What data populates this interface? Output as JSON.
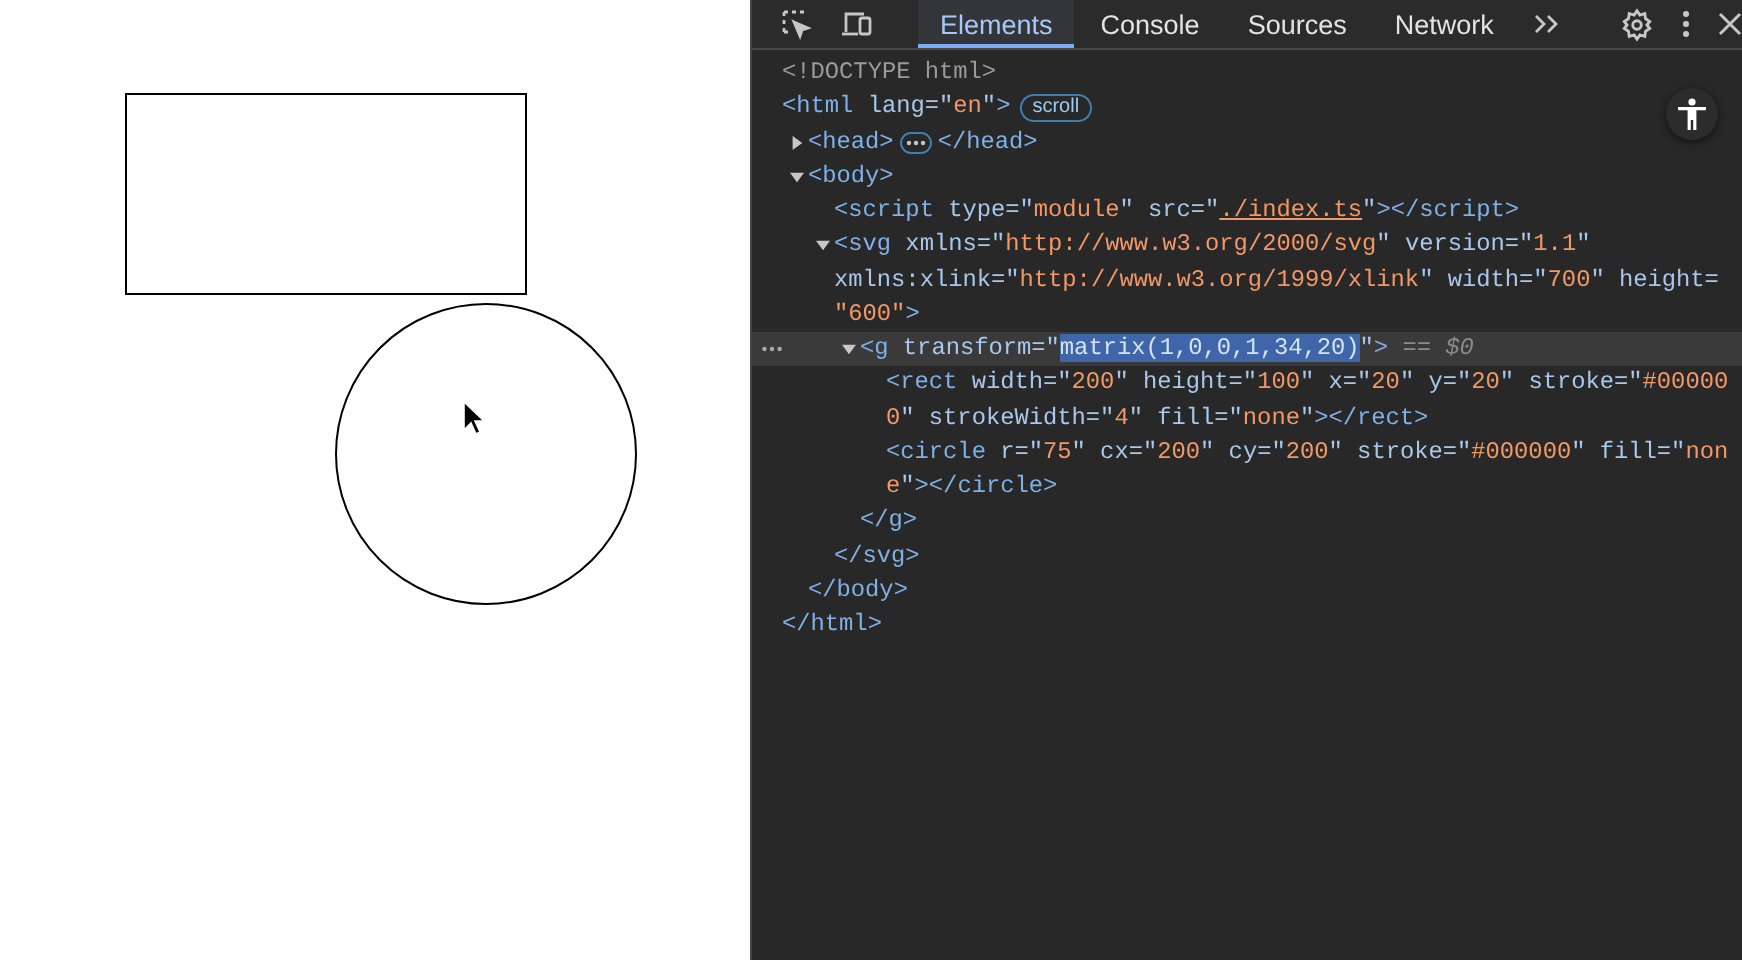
{
  "toolbar": {
    "tabs": [
      {
        "label": "Elements",
        "selected": true
      },
      {
        "label": "Console",
        "selected": false
      },
      {
        "label": "Sources",
        "selected": false
      },
      {
        "label": "Network",
        "selected": false
      }
    ]
  },
  "dom_tree": [
    {
      "selected": false,
      "lines": [
        [
          {
            "kind": "doctype",
            "t": "<!DOCTYPE html>"
          }
        ]
      ]
    },
    {
      "selected": false,
      "lines": [
        [
          {
            "kind": "tag",
            "t": "<html"
          },
          {
            "kind": "attr",
            "t": " lang=\""
          },
          {
            "kind": "val",
            "t": "en"
          },
          {
            "kind": "attr",
            "t": "\""
          },
          {
            "kind": "tag",
            "t": ">"
          },
          {
            "kind": "badge",
            "t": "scroll"
          }
        ]
      ],
      "close": [
        {
          "kind": "tag",
          "t": "</html>"
        }
      ],
      "children": [
        {
          "selected": false,
          "expanded": false,
          "lines": [
            [
              {
                "kind": "tag",
                "t": "<head>"
              },
              {
                "kind": "ellipsis"
              },
              {
                "kind": "tag",
                "t": "</head>"
              }
            ]
          ]
        },
        {
          "selected": false,
          "expanded": true,
          "lines": [
            [
              {
                "kind": "tag",
                "t": "<body>"
              }
            ]
          ],
          "close": [
            {
              "kind": "tag",
              "t": "</body>"
            }
          ],
          "children": [
            {
              "selected": false,
              "lines": [
                [
                  {
                    "kind": "tag",
                    "t": "<script"
                  },
                  {
                    "kind": "attr",
                    "t": " type=\""
                  },
                  {
                    "kind": "val",
                    "t": "module"
                  },
                  {
                    "kind": "attr",
                    "t": "\" src=\""
                  },
                  {
                    "kind": "link",
                    "t": "./index.ts"
                  },
                  {
                    "kind": "attr",
                    "t": "\""
                  },
                  {
                    "kind": "tag",
                    "t": "></script>"
                  }
                ]
              ]
            },
            {
              "selected": false,
              "expanded": true,
              "lines": [
                [
                  {
                    "kind": "tag",
                    "t": "<svg"
                  },
                  {
                    "kind": "attr",
                    "t": " xmlns=\""
                  },
                  {
                    "kind": "val",
                    "t": "http://www.w3.org/2000/svg"
                  },
                  {
                    "kind": "attr",
                    "t": "\" version=\""
                  },
                  {
                    "kind": "val",
                    "t": "1.1"
                  },
                  {
                    "kind": "attr",
                    "t": "\""
                  }
                ],
                [
                  {
                    "kind": "attr",
                    "t": "xmlns:xlink=\""
                  },
                  {
                    "kind": "val",
                    "t": "http://www.w3.org/1999/xlink"
                  },
                  {
                    "kind": "attr",
                    "t": "\" width=\""
                  },
                  {
                    "kind": "val",
                    "t": "700"
                  },
                  {
                    "kind": "attr",
                    "t": "\" height="
                  }
                ],
                [
                  {
                    "kind": "val",
                    "t": "\"600\""
                  },
                  {
                    "kind": "tag",
                    "t": ">"
                  }
                ]
              ],
              "close": [
                {
                  "kind": "tag",
                  "t": "</svg>"
                }
              ],
              "children": [
                {
                  "selected": true,
                  "expanded": true,
                  "lines": [
                    [
                      {
                        "kind": "tag",
                        "t": "<g"
                      },
                      {
                        "kind": "attr",
                        "t": " transform=\""
                      },
                      {
                        "kind": "sel",
                        "t": "matrix(1,0,0,1,34,20)"
                      },
                      {
                        "kind": "attr",
                        "t": "\""
                      },
                      {
                        "kind": "tag",
                        "t": ">"
                      },
                      {
                        "kind": "dim",
                        "t": " == $0"
                      }
                    ]
                  ],
                  "close": [
                    {
                      "kind": "tag",
                      "t": "</g>"
                    }
                  ],
                  "children": [
                    {
                      "selected": false,
                      "lines": [
                        [
                          {
                            "kind": "tag",
                            "t": "<rect"
                          },
                          {
                            "kind": "attr",
                            "t": " width=\""
                          },
                          {
                            "kind": "val",
                            "t": "200"
                          },
                          {
                            "kind": "attr",
                            "t": "\" height=\""
                          },
                          {
                            "kind": "val",
                            "t": "100"
                          },
                          {
                            "kind": "attr",
                            "t": "\" x=\""
                          },
                          {
                            "kind": "val",
                            "t": "20"
                          },
                          {
                            "kind": "attr",
                            "t": "\" y=\""
                          },
                          {
                            "kind": "val",
                            "t": "20"
                          },
                          {
                            "kind": "attr",
                            "t": "\" stroke=\""
                          },
                          {
                            "kind": "val",
                            "t": "#00000"
                          }
                        ],
                        [
                          {
                            "kind": "val",
                            "t": "0"
                          },
                          {
                            "kind": "attr",
                            "t": "\" strokeWidth=\""
                          },
                          {
                            "kind": "val",
                            "t": "4"
                          },
                          {
                            "kind": "attr",
                            "t": "\" fill=\""
                          },
                          {
                            "kind": "val",
                            "t": "none"
                          },
                          {
                            "kind": "attr",
                            "t": "\""
                          },
                          {
                            "kind": "tag",
                            "t": "></rect>"
                          }
                        ]
                      ]
                    },
                    {
                      "selected": false,
                      "lines": [
                        [
                          {
                            "kind": "tag",
                            "t": "<circle"
                          },
                          {
                            "kind": "attr",
                            "t": " r=\""
                          },
                          {
                            "kind": "val",
                            "t": "75"
                          },
                          {
                            "kind": "attr",
                            "t": "\" cx=\""
                          },
                          {
                            "kind": "val",
                            "t": "200"
                          },
                          {
                            "kind": "attr",
                            "t": "\" cy=\""
                          },
                          {
                            "kind": "val",
                            "t": "200"
                          },
                          {
                            "kind": "attr",
                            "t": "\" stroke=\""
                          },
                          {
                            "kind": "val",
                            "t": "#000000"
                          },
                          {
                            "kind": "attr",
                            "t": "\" fill=\""
                          },
                          {
                            "kind": "val",
                            "t": "non"
                          }
                        ],
                        [
                          {
                            "kind": "val",
                            "t": "e"
                          },
                          {
                            "kind": "attr",
                            "t": "\""
                          },
                          {
                            "kind": "tag",
                            "t": "></circle>"
                          }
                        ]
                      ]
                    }
                  ]
                }
              ]
            }
          ]
        }
      ]
    }
  ]
}
